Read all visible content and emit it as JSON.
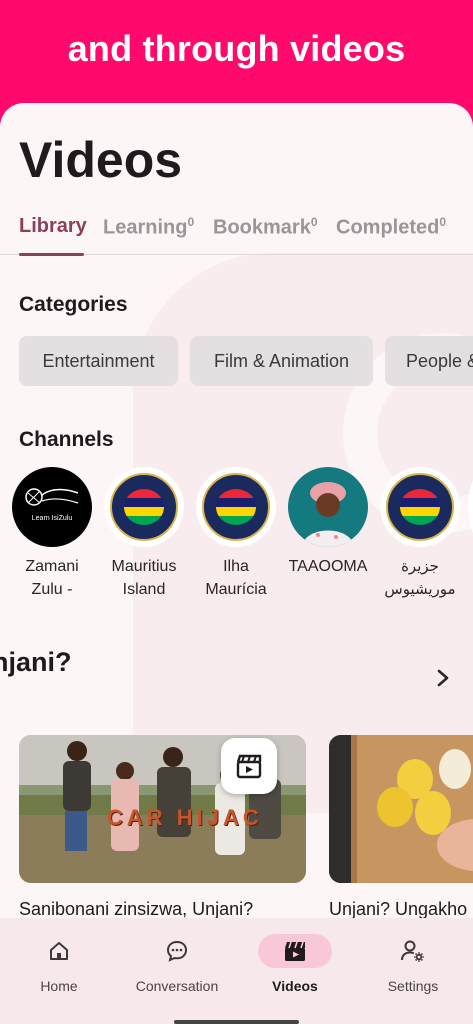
{
  "banner": {
    "text": "and through videos"
  },
  "page": {
    "title": "Videos"
  },
  "tabs": [
    {
      "label": "Library",
      "count": ""
    },
    {
      "label": "Learning",
      "count": "0"
    },
    {
      "label": "Bookmark",
      "count": "0"
    },
    {
      "label": "Completed",
      "count": "0"
    }
  ],
  "categories": {
    "heading": "Categories",
    "items": [
      "Entertainment",
      "Film & Animation",
      "People &"
    ]
  },
  "channels": {
    "heading": "Channels",
    "items": [
      {
        "name": "Zamani Zulu -",
        "avatar_text": "Learn IsiZulu"
      },
      {
        "name": "Mauritius Island",
        "avatar_text": "ILE MAURICE"
      },
      {
        "name": "Ilha Maurícia",
        "avatar_text": "ILE MAURICE"
      },
      {
        "name": "TAAOOMA",
        "avatar_text": ""
      },
      {
        "name": "جزيرة موريشيوس",
        "avatar_text": "ILE MAURICE"
      }
    ]
  },
  "playlist": {
    "heading": "njani?",
    "cards": [
      {
        "title": "Sanibonani zinsizwa, Unjani?",
        "overlay": "CAR HIJAC"
      },
      {
        "title": "Unjani? Ungakho"
      }
    ]
  },
  "nav": {
    "items": [
      {
        "label": "Home",
        "icon": "home-icon"
      },
      {
        "label": "Conversation",
        "icon": "chat-icon"
      },
      {
        "label": "Videos",
        "icon": "clapperboard-icon"
      },
      {
        "label": "Settings",
        "icon": "user-settings-icon"
      }
    ],
    "active": "Videos"
  },
  "colors": {
    "brand": "#ff0a6c",
    "accent": "#8a3f5a",
    "nav_active": "#f9c8d8"
  }
}
